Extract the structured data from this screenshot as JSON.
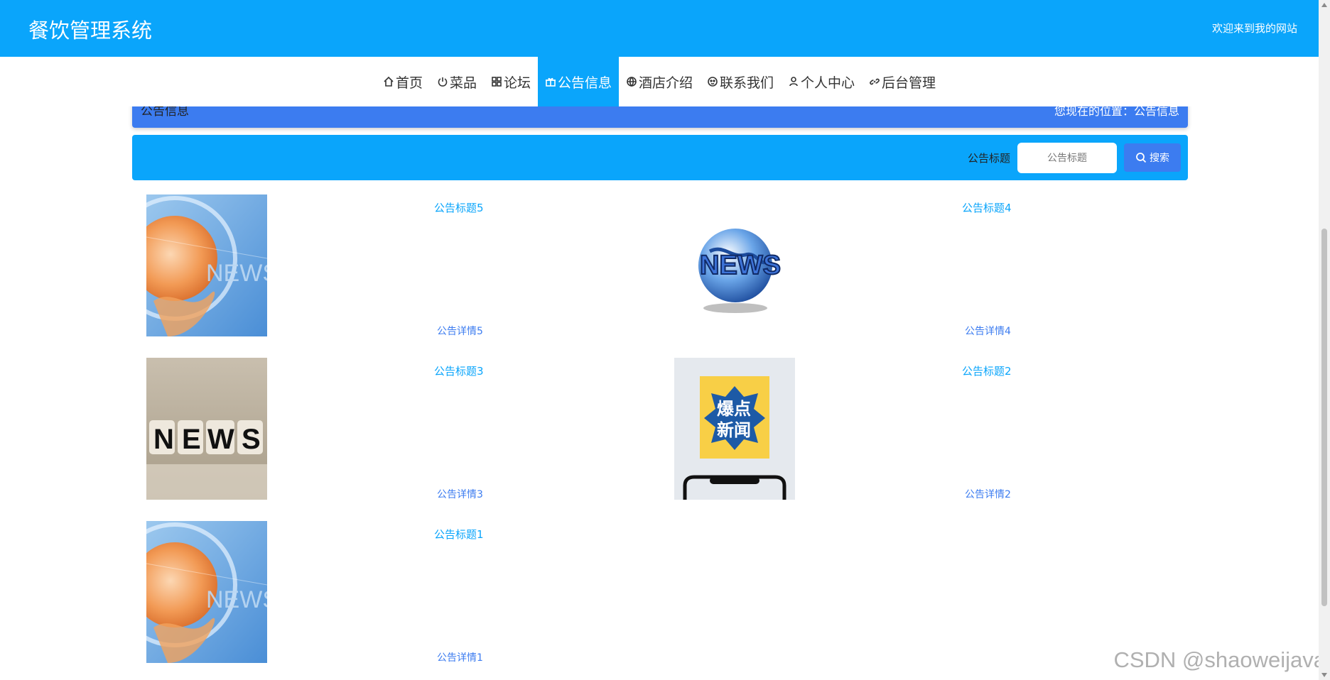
{
  "header": {
    "title": "餐饮管理系统",
    "welcome": "欢迎来到我的网站"
  },
  "nav": {
    "items": [
      {
        "label": "首页",
        "icon": "home-icon"
      },
      {
        "label": "菜品",
        "icon": "power-icon"
      },
      {
        "label": "论坛",
        "icon": "grid-icon"
      },
      {
        "label": "公告信息",
        "icon": "gift-icon",
        "active": true
      },
      {
        "label": "酒店介绍",
        "icon": "globe-icon"
      },
      {
        "label": "联系我们",
        "icon": "contact-icon"
      },
      {
        "label": "个人中心",
        "icon": "user-icon"
      },
      {
        "label": "后台管理",
        "icon": "link-icon"
      }
    ]
  },
  "breadcrumb": {
    "title": "公告信息",
    "path": "您现在的位置：公告信息"
  },
  "search": {
    "label": "公告标题",
    "placeholder": "公告标题",
    "button": "搜索"
  },
  "notices": [
    {
      "title": "公告标题5",
      "detail": "公告详情5",
      "image": "news-globe-hand"
    },
    {
      "title": "公告标题4",
      "detail": "公告详情4",
      "image": "news-globe-3d"
    },
    {
      "title": "公告标题3",
      "detail": "公告详情3",
      "image": "news-dice"
    },
    {
      "title": "公告标题2",
      "detail": "公告详情2",
      "image": "breaking-news-phone"
    },
    {
      "title": "公告标题1",
      "detail": "公告详情1",
      "image": "news-globe-hand"
    }
  ],
  "colors": {
    "primary": "#0aa5fb",
    "secondary": "#3c7cf0"
  },
  "watermark": "CSDN @shaoweijava"
}
